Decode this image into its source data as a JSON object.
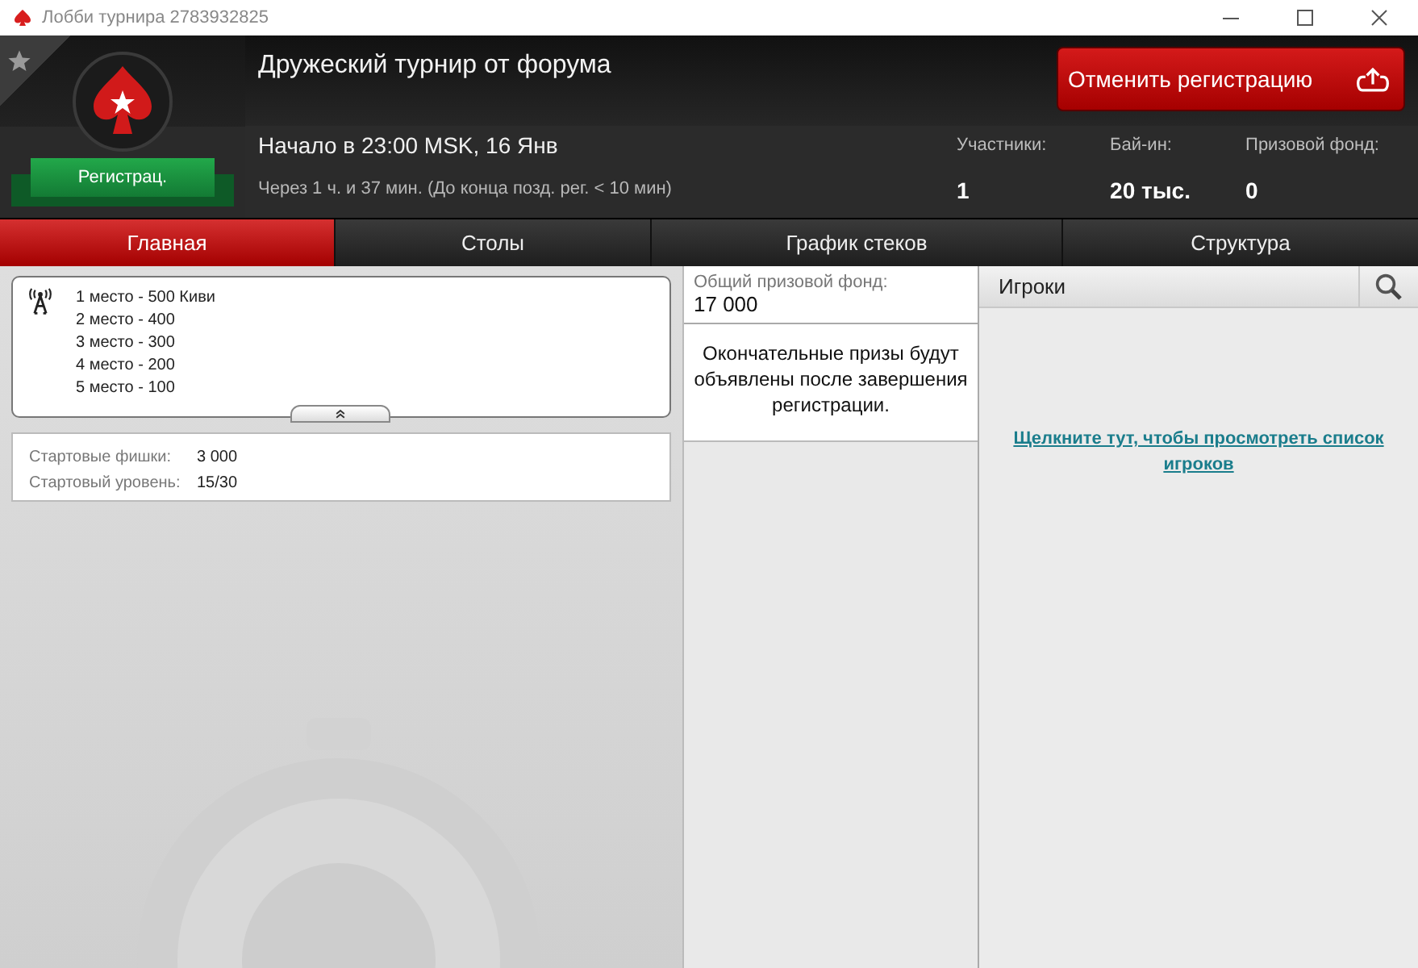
{
  "window": {
    "title": "Лобби турнира 2783932825"
  },
  "header": {
    "favorite": false,
    "title": "Дружеский турнир от форума",
    "start": "Начало в 23:00 MSK, 16 Янв",
    "countdown": "Через 1 ч. и 37 мин. (До конца позд. рег. < 10 мин)",
    "status": "Регистрац.",
    "action_button": "Отменить регистрацию",
    "stats": [
      {
        "label": "Участники:",
        "value": "1"
      },
      {
        "label": "Бай-ин:",
        "value": "20 тыс."
      },
      {
        "label": "Призовой фонд:",
        "value": "0"
      }
    ]
  },
  "tabs": [
    {
      "label": "Главная",
      "selected": true
    },
    {
      "label": "Столы",
      "selected": false
    },
    {
      "label": "График стеков",
      "selected": false
    },
    {
      "label": "Структура",
      "selected": false
    }
  ],
  "prizes": {
    "expanded": true,
    "items": [
      "1 место - 500 Киви",
      "2 место - 400",
      "3 место - 300",
      "4 место - 200",
      "5 место - 100"
    ]
  },
  "start_info": [
    {
      "label": "Стартовые фишки:",
      "value": "3 000"
    },
    {
      "label": "Стартовый уровень:",
      "value": "15/30"
    }
  ],
  "prize_pool": {
    "label": "Общий призовой фонд:",
    "value": "17 000",
    "note": "Окончательные призы будут объявлены после завершения регистрации."
  },
  "players": {
    "title": "Игроки",
    "link": "Щелкните тут, чтобы просмотреть список игроков"
  }
}
